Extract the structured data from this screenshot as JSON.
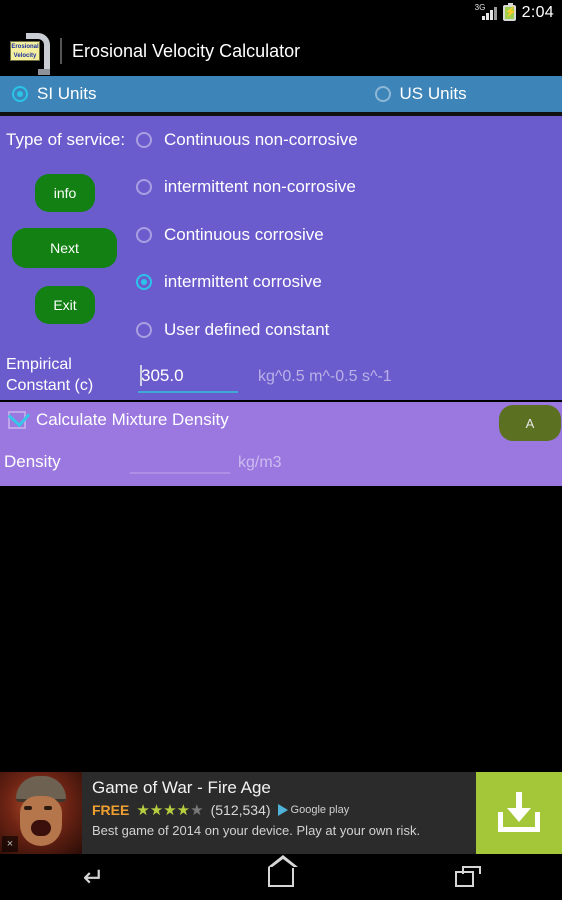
{
  "statusbar": {
    "network": "3G",
    "time": "2:04",
    "signal_icon": "signal-3g-icon",
    "battery_icon": "battery-charging-icon"
  },
  "titlebar": {
    "title": "Erosional Velocity Calculator",
    "icon_line1": "Erosional",
    "icon_line2": "Velocity"
  },
  "units": {
    "si_label": "SI Units",
    "us_label": "US Units",
    "selected": "SI Units"
  },
  "service": {
    "section_label": "Type of service:",
    "options": [
      {
        "label": "Continuous non-corrosive",
        "selected": false
      },
      {
        "label": "intermittent non-corrosive",
        "selected": false
      },
      {
        "label": "Continuous corrosive",
        "selected": false
      },
      {
        "label": "intermittent corrosive",
        "selected": true
      },
      {
        "label": "User defined constant",
        "selected": false
      }
    ]
  },
  "buttons": {
    "info": "info",
    "next": "Next",
    "exit": "Exit",
    "a": "A"
  },
  "empirical": {
    "label": "Empirical Constant (c)",
    "value": "305.0",
    "placeholder": "",
    "unit": "kg^0.5 m^-0.5 s^-1"
  },
  "mixture": {
    "checkbox_label": "Calculate Mixture Density",
    "checked": true,
    "density_label": "Density",
    "density_value": "",
    "density_placeholder": "",
    "density_unit": "kg/m3"
  },
  "ad": {
    "title": "Game of War - Fire Age",
    "price": "FREE",
    "stars_filled": 4,
    "stars_total": 5,
    "rating_count": "(512,534)",
    "store": "Google play",
    "description": "Best game of 2014 on your device. Play at your own risk.",
    "cta_icon": "download-icon",
    "close_label": "×"
  },
  "navbar": {
    "back": "back-icon",
    "home": "home-icon",
    "recents": "recents-icon"
  },
  "colors": {
    "panel_purple": "#6a5ccd",
    "panel_light_purple": "#9b77e0",
    "units_bar_blue": "#3d84b8",
    "accent_cyan": "#2bc4e8",
    "button_green": "#128012",
    "button_olive": "#5c7022",
    "ad_cta_green": "#a4c639"
  }
}
